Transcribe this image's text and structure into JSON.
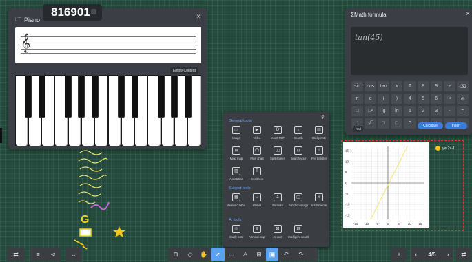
{
  "room_code": "816901",
  "piano": {
    "title": "Piano",
    "icon": "folder-icon",
    "empty_label": "Empty Content",
    "clef": "𝄞",
    "close": "×"
  },
  "math": {
    "title": "ΣMath formula",
    "formula": "tan(45)",
    "close": "×",
    "keys": [
      "sin",
      "cos",
      "tan",
      "𝑥",
      "T",
      "8",
      "9",
      "÷",
      "⌫",
      "π",
      "e",
      "(",
      ")",
      "4",
      "5",
      "6",
      "×",
      "⊘",
      "□",
      "□²",
      "lg",
      "ln",
      "1",
      "2",
      "3",
      "-",
      "=",
      ".1",
      "√‾",
      "□",
      "□",
      "0",
      ".",
      "+",
      "←",
      "→"
    ],
    "rad_label": "Rad",
    "calculate_label": "Calculate",
    "insert_label": "Insert"
  },
  "tools": {
    "general_title": "General tools",
    "general": [
      {
        "label": "Image",
        "icon": "image-icon",
        "glyph": "▭"
      },
      {
        "label": "Video",
        "icon": "video-icon",
        "glyph": "▶"
      },
      {
        "label": "Insert PDF",
        "icon": "pdf-icon",
        "glyph": "D"
      },
      {
        "label": "Search",
        "icon": "search-icon",
        "glyph": "⌕"
      },
      {
        "label": "Sticky note",
        "icon": "sticky-note-icon",
        "glyph": "▤"
      },
      {
        "label": "Mind map",
        "icon": "mind-map-icon",
        "glyph": "⊞"
      },
      {
        "label": "Flow chart",
        "icon": "flow-chart-icon",
        "glyph": "凸"
      },
      {
        "label": "Split screen",
        "icon": "split-screen-icon",
        "glyph": "▯▯"
      },
      {
        "label": "Search your",
        "icon": "screen-search-icon",
        "glyph": "⊡"
      },
      {
        "label": "File transfer",
        "icon": "file-transfer-icon",
        "glyph": "⇪"
      },
      {
        "label": "Annotation",
        "icon": "annotation-icon",
        "glyph": "▥"
      },
      {
        "label": "Insert text",
        "icon": "text-icon",
        "glyph": "T"
      }
    ],
    "subject_title": "Subject tools",
    "subject": [
      {
        "label": "Periodic table",
        "icon": "periodic-table-icon",
        "glyph": "▦"
      },
      {
        "label": "Planet",
        "icon": "planet-icon",
        "glyph": "◒"
      },
      {
        "label": "Formula",
        "icon": "formula-icon",
        "glyph": "Σ"
      },
      {
        "label": "Function image",
        "icon": "function-image-icon",
        "glyph": "◱"
      },
      {
        "label": "Instruments",
        "icon": "instruments-icon",
        "glyph": "♬"
      }
    ],
    "ai_title": "AI tools",
    "ai": [
      {
        "label": "Study note",
        "icon": "ai-note-icon",
        "glyph": "◎"
      },
      {
        "label": "AI mind map",
        "icon": "ai-mind-map-icon",
        "glyph": "⊞"
      },
      {
        "label": "AI quiz",
        "icon": "ai-quiz-icon",
        "glyph": "⊠"
      },
      {
        "label": "Intelligent search",
        "icon": "intelligent-search-icon",
        "glyph": "⊟"
      }
    ]
  },
  "graph": {
    "legend": "y= 2x-1",
    "x_ticks": [
      "-15",
      "-10",
      "-5",
      "0",
      "5",
      "10",
      "15"
    ],
    "y_ticks": [
      "15",
      "10",
      "5",
      "0",
      "-5",
      "-10",
      "-15"
    ]
  },
  "doodle_letter": "G",
  "toolbar": {
    "page_indicator": "4/5"
  }
}
